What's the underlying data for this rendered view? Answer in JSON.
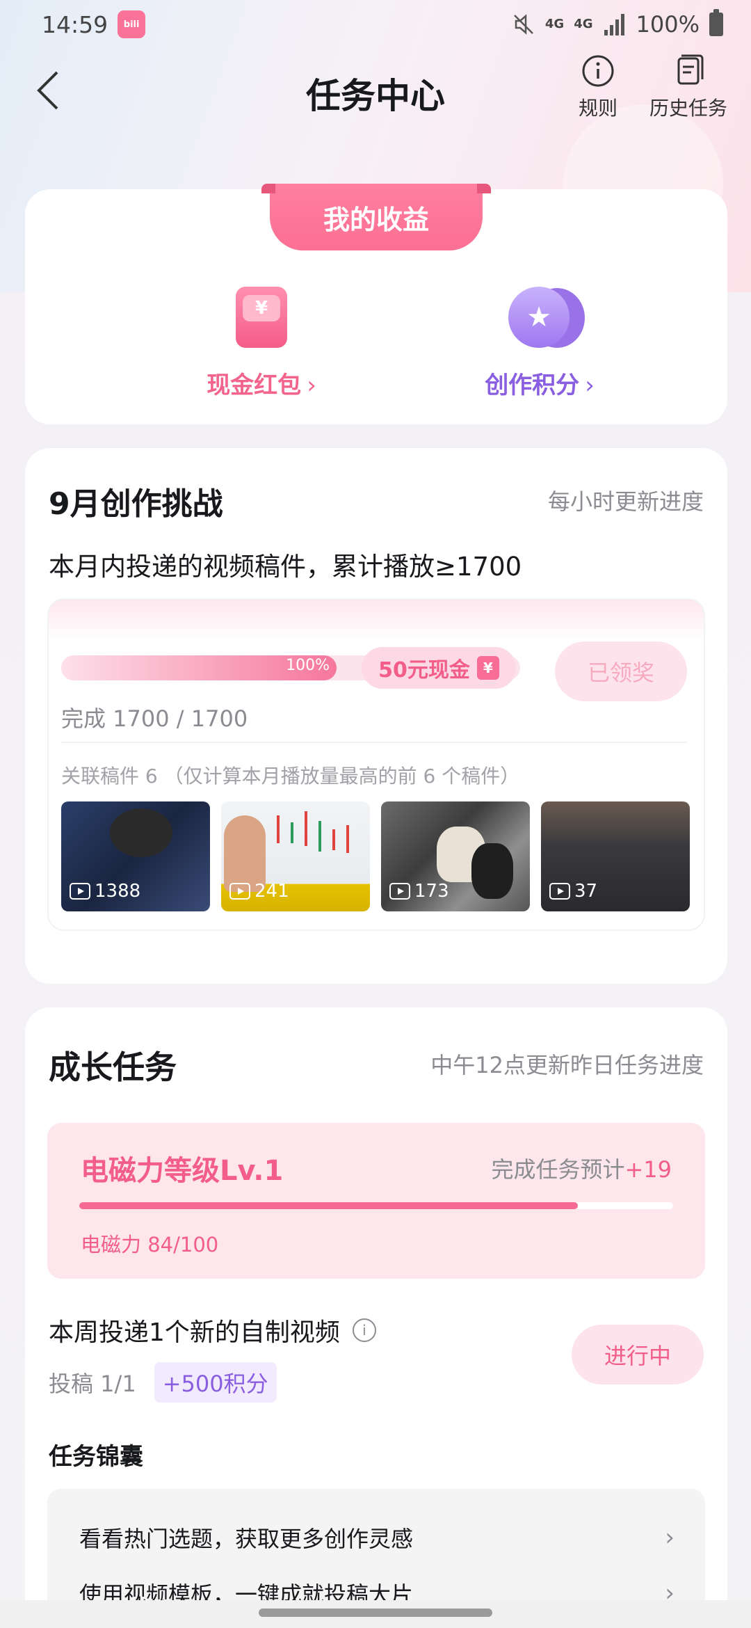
{
  "status_bar": {
    "time": "14:59",
    "app_icon_text": "bili",
    "network": "4G",
    "network2": "4G",
    "battery": "100%"
  },
  "nav": {
    "title": "任务中心",
    "rules_label": "规则",
    "history_label": "历史任务"
  },
  "earnings": {
    "tab_label": "我的收益",
    "cash_label": "现金红包",
    "points_label": "创作积分",
    "chevron": "›",
    "yen": "¥"
  },
  "challenge": {
    "title": "9月创作挑战",
    "note": "每小时更新进度",
    "description": "本月内投递的视频稿件，累计播放≥1700",
    "progress_percent": 100,
    "progress_label": "100%",
    "reward_label": "50元现金",
    "reward_icon": "¥",
    "claimed_button": "已领奖",
    "complete_text": "完成 1700 / 1700",
    "related_text": "关联稿件 6 （仅计算本月播放量最高的前 6 个稿件）",
    "videos": [
      {
        "plays": "1388"
      },
      {
        "plays": "241"
      },
      {
        "plays": "173"
      },
      {
        "plays": "37"
      }
    ]
  },
  "growth": {
    "title": "成长任务",
    "note": "中午12点更新昨日任务进度",
    "level_title": "电磁力等级Lv.1",
    "level_est_prefix": "完成任务预计",
    "level_est_value": "+19",
    "level_value_text": "电磁力 84/100",
    "level_fraction": 0.84,
    "task_title": "本周投递1个新的自制视频",
    "task_info_icon": "i",
    "task_count": "投稿 1/1",
    "task_points": "+500积分",
    "task_button": "进行中",
    "kit_title": "任务锦囊",
    "kit_items": [
      {
        "label": "看看热门选题，获取更多创作灵感",
        "arrow": "›"
      },
      {
        "label": "使用视频模板，一键成就投稿大片",
        "arrow": "›"
      }
    ]
  },
  "colors": {
    "accent_pink": "#fb7299",
    "accent_purple": "#8a5ee0"
  }
}
